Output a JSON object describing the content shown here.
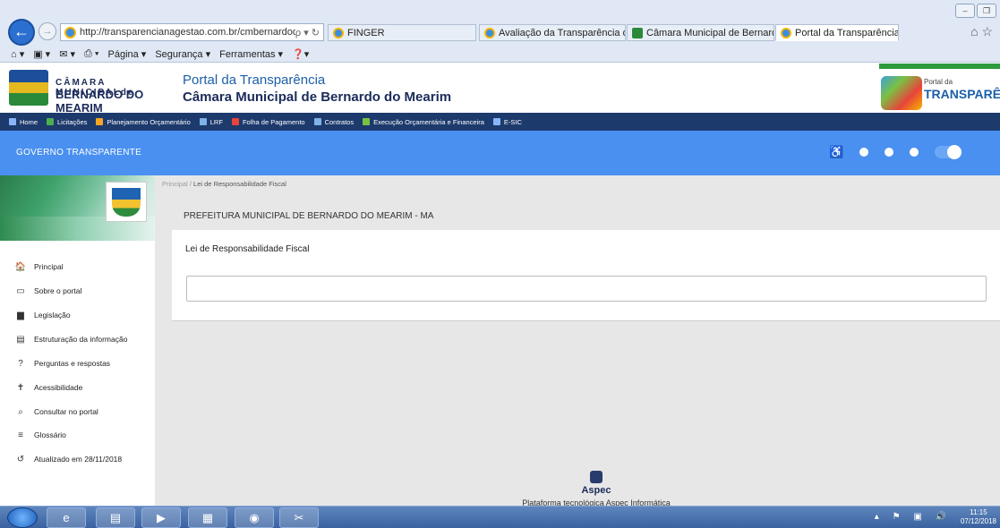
{
  "browser": {
    "url": "http://transparencianagestao.com.br/cmbernardodo",
    "url_suffix": "ρ ▾ ↻",
    "address_tab": "FINGER",
    "tabs": [
      {
        "label": "Avaliação da Transparência do..."
      },
      {
        "label": "Câmara Municipal de Bernard..."
      },
      {
        "label": "Portal da Transparência",
        "close": "×"
      }
    ],
    "menu": [
      "Página ▾",
      "Segurança ▾",
      "Ferramentas ▾"
    ]
  },
  "header": {
    "logo_line1": "CÂMARA MUNICIPALde",
    "logo_line2": "BERNARDO DO MEARIM",
    "portal_title": "Portal da Transparência",
    "portal_subtitle": "Câmara Municipal de Bernardo do Mearim",
    "right_logo_small": "Portal da",
    "right_logo_big": "TRANSPARÊNC"
  },
  "nav": [
    {
      "label": "Home",
      "color": "#8ab4f8"
    },
    {
      "label": "Licitações",
      "color": "#4caf50"
    },
    {
      "label": "Planejamento Orçamentário",
      "color": "#f5a623"
    },
    {
      "label": "LRF",
      "color": "#7fb3e8"
    },
    {
      "label": "Folha de Pagamento",
      "color": "#e8443a"
    },
    {
      "label": "Contratos",
      "color": "#7fb3e8"
    },
    {
      "label": "Execução Orçamentária e Financeira",
      "color": "#7ac143"
    },
    {
      "label": "E-SIC",
      "color": "#8ab4f8"
    }
  ],
  "gov": {
    "title": "GOVERNO TRANSPARENTE"
  },
  "sidebar": {
    "items": [
      {
        "label": "Principal",
        "icon": "home-icon",
        "glyph": "🏠"
      },
      {
        "label": "Sobre o portal",
        "icon": "folder-icon",
        "glyph": "▭"
      },
      {
        "label": "Legislação",
        "icon": "document-icon",
        "glyph": "▆"
      },
      {
        "label": "Estruturação da informação",
        "icon": "structure-icon",
        "glyph": "▤"
      },
      {
        "label": "Perguntas e respostas",
        "icon": "question-icon",
        "glyph": "?"
      },
      {
        "label": "Acessibilidade",
        "icon": "accessibility-icon",
        "glyph": "✝"
      },
      {
        "label": "Consultar no portal",
        "icon": "search-icon",
        "glyph": "⌕"
      },
      {
        "label": "Glossário",
        "icon": "list-icon",
        "glyph": "≡"
      },
      {
        "label": "Atualizado em 28/11/2018",
        "icon": "history-icon",
        "glyph": "↺"
      }
    ]
  },
  "main": {
    "breadcrumb_home": "Principal",
    "breadcrumb_sep": "/",
    "breadcrumb_current": "Lei de Responsabilidade Fiscal",
    "prefeitura": "PREFEITURA MUNICIPAL DE BERNARDO DO MEARIM - MA",
    "panel_title": "Lei de Responsabilidade Fiscal"
  },
  "footer": {
    "brand": "Aspec",
    "platform": "Plataforma tecnológica Aspec Informática"
  },
  "taskbar": {
    "time": "11:15",
    "date": "07/12/2018"
  }
}
